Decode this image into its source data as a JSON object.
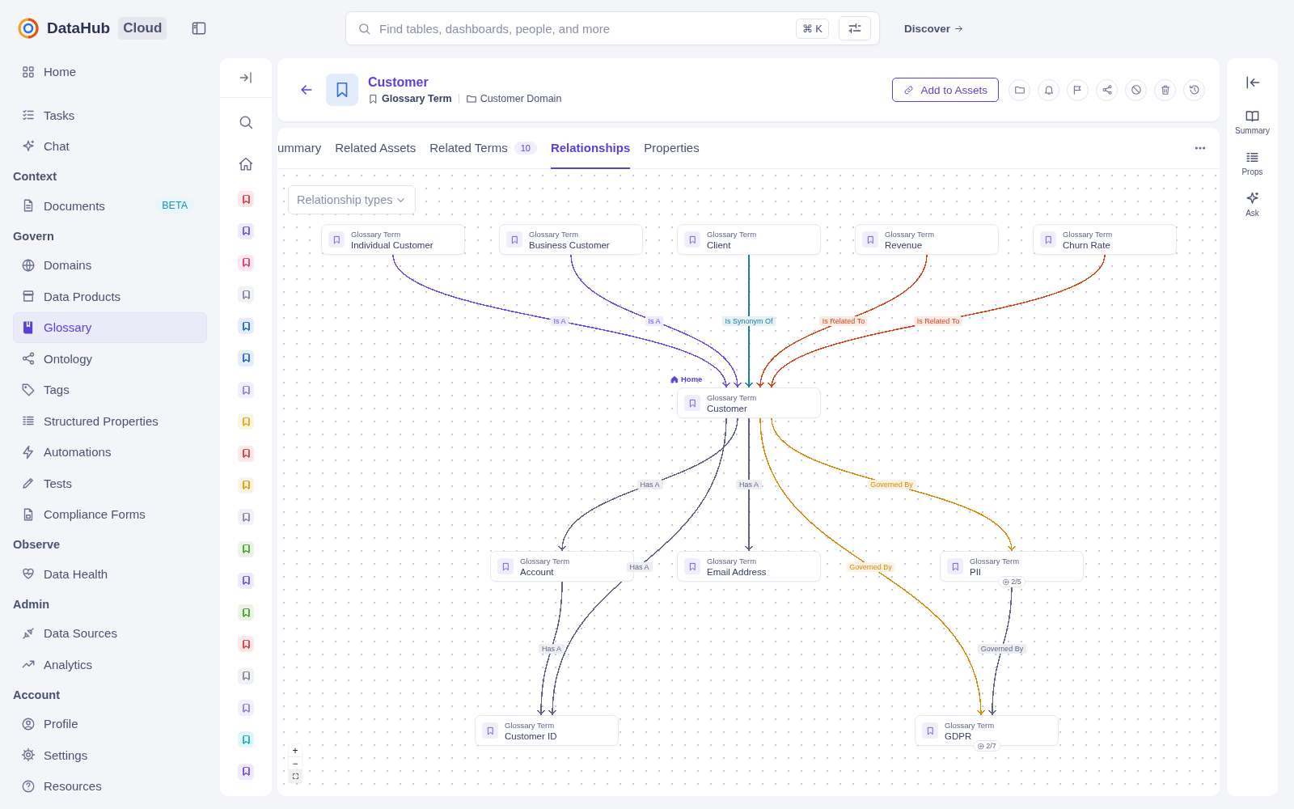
{
  "app": {
    "name": "DataHub",
    "edition": "Cloud"
  },
  "search": {
    "placeholder": "Find tables, dashboards, people, and more",
    "shortcut": "⌘ K"
  },
  "discover": {
    "label": "Discover"
  },
  "nav": [
    {
      "kind": "item",
      "label": "Home",
      "selected": false
    },
    {
      "kind": "item",
      "label": "Tasks",
      "selected": false
    },
    {
      "kind": "item",
      "label": "Chat",
      "selected": false
    },
    {
      "kind": "section",
      "label": "Context"
    },
    {
      "kind": "item",
      "label": "Documents",
      "badge": "BETA",
      "selected": false
    },
    {
      "kind": "section",
      "label": "Govern"
    },
    {
      "kind": "item",
      "label": "Domains",
      "selected": false
    },
    {
      "kind": "item",
      "label": "Data Products",
      "selected": false
    },
    {
      "kind": "item",
      "label": "Glossary",
      "selected": true
    },
    {
      "kind": "item",
      "label": "Ontology",
      "selected": false
    },
    {
      "kind": "item",
      "label": "Tags",
      "selected": false
    },
    {
      "kind": "item",
      "label": "Structured Properties",
      "selected": false
    },
    {
      "kind": "item",
      "label": "Automations",
      "selected": false
    },
    {
      "kind": "item",
      "label": "Tests",
      "selected": false
    },
    {
      "kind": "item",
      "label": "Compliance Forms",
      "selected": false
    },
    {
      "kind": "section",
      "label": "Observe"
    },
    {
      "kind": "item",
      "label": "Data Health",
      "selected": false
    },
    {
      "kind": "section",
      "label": "Admin"
    },
    {
      "kind": "item",
      "label": "Data Sources",
      "selected": false
    },
    {
      "kind": "item",
      "label": "Analytics",
      "selected": false
    },
    {
      "kind": "section",
      "label": "Account"
    },
    {
      "kind": "item",
      "label": "Profile",
      "selected": false
    },
    {
      "kind": "item",
      "label": "Settings",
      "selected": false
    },
    {
      "kind": "item",
      "label": "Resources",
      "selected": false
    }
  ],
  "rail": {
    "items": [
      {
        "color": "#e5484d"
      },
      {
        "color": "#7c5cf0"
      },
      {
        "color": "#e5487a"
      },
      {
        "color": "#8b90a7"
      },
      {
        "color": "#2f6fd6"
      },
      {
        "color": "#2f6fd6"
      },
      {
        "color": "#9a86f0"
      },
      {
        "color": "#e8b020"
      },
      {
        "color": "#e5484d"
      },
      {
        "color": "#e8a010"
      },
      {
        "color": "#8b90a7"
      },
      {
        "color": "#5aa83a"
      },
      {
        "color": "#7c5cf0"
      },
      {
        "color": "#5aa83a"
      },
      {
        "color": "#e5484d"
      },
      {
        "color": "#8b90a7"
      },
      {
        "color": "#9a86f0"
      },
      {
        "color": "#28b8d0"
      },
      {
        "color": "#7c5cf0"
      }
    ]
  },
  "entity": {
    "title": "Customer",
    "type": "Glossary Term",
    "domain": "Customer Domain",
    "add_button": "Add to Assets"
  },
  "tabs": [
    {
      "label": "ummary",
      "selected": false
    },
    {
      "label": "Related Assets",
      "selected": false
    },
    {
      "label": "Related Terms",
      "count": "10",
      "selected": false
    },
    {
      "label": "Relationships",
      "selected": true
    },
    {
      "label": "Properties",
      "selected": false
    }
  ],
  "graph": {
    "filter": {
      "label": "Relationship types"
    },
    "nodes": [
      {
        "type": "Glossary Term",
        "name": "Individual Customer"
      },
      {
        "type": "Glossary Term",
        "name": "Business Customer"
      },
      {
        "type": "Glossary Term",
        "name": "Client"
      },
      {
        "type": "Glossary Term",
        "name": "Revenue"
      },
      {
        "type": "Glossary Term",
        "name": "Churn Rate"
      },
      {
        "type": "Glossary Term",
        "name": "Customer",
        "marker": "Home"
      },
      {
        "type": "Glossary Term",
        "name": "Account"
      },
      {
        "type": "Glossary Term",
        "name": "Email Address"
      },
      {
        "type": "Glossary Term",
        "name": "PII",
        "count": "2/5"
      },
      {
        "type": "Glossary Term",
        "name": "Customer ID"
      },
      {
        "type": "Glossary Term",
        "name": "GDPR",
        "count": "2/7"
      }
    ],
    "edges": [
      {
        "label": "Is A",
        "color": "#6b4ef0"
      },
      {
        "label": "Is A",
        "color": "#6b4ef0"
      },
      {
        "label": "Is Synonym Of",
        "color": "#1a7fa0"
      },
      {
        "label": "Is Related To",
        "color": "#d9461b"
      },
      {
        "label": "Is Related To",
        "color": "#d9461b"
      },
      {
        "label": "Has A",
        "color": "#5f6483"
      },
      {
        "label": "Has A",
        "color": "#5f6483"
      },
      {
        "label": "Has A",
        "color": "#5f6483"
      },
      {
        "label": "Governed By",
        "color": "#d98a0a"
      },
      {
        "label": "Governed By",
        "color": "#d98a0a"
      },
      {
        "label": "Has A",
        "color": "#5f6483"
      },
      {
        "label": "Governed By",
        "color": "#5f6483"
      }
    ],
    "zoom": {
      "in": "+",
      "out": "−"
    }
  },
  "right_rail": [
    {
      "label": "Summary"
    },
    {
      "label": "Props"
    },
    {
      "label": "Ask"
    }
  ]
}
